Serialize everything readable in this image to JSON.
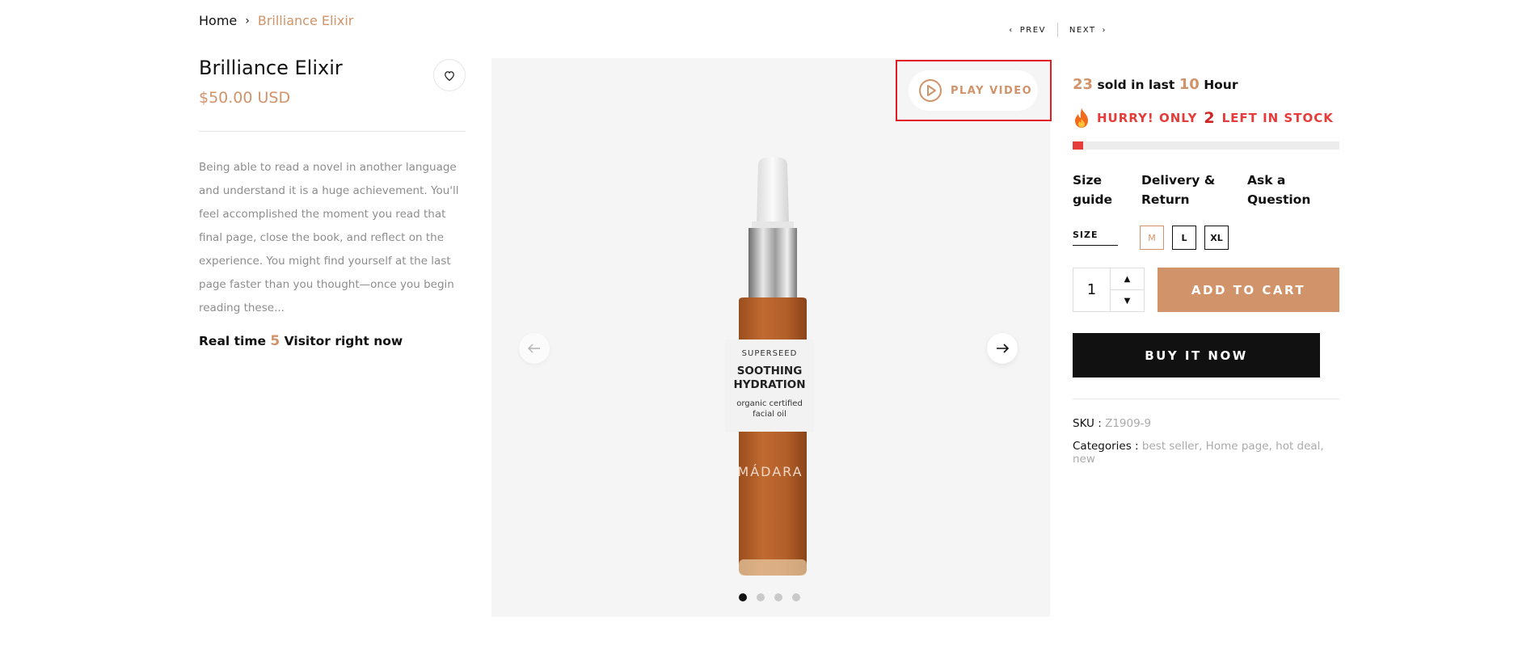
{
  "breadcrumb": {
    "home": "Home",
    "separator": "›",
    "current": "Brilliance Elixir"
  },
  "nav": {
    "prev": "PREV",
    "next": "NEXT"
  },
  "product": {
    "title": "Brilliance Elixir",
    "price": "$50.00 USD",
    "description": "Being able to read a novel in another language and understand it is a huge achievement. You'll feel accomplished the moment you read that final page, close the book, and reflect on the experience. You might find yourself at the last page faster than you thought—once you begin reading these...",
    "visitor_prefix": "Real time",
    "visitor_count": "5",
    "visitor_suffix": "Visitor right now"
  },
  "gallery": {
    "play_video": "PLAY VIDEO",
    "label_brand_line": "SUPERSEED",
    "label_title_1": "SOOTHING",
    "label_title_2": "HYDRATION",
    "label_sub_1": "organic certified",
    "label_sub_2": "facial oil",
    "bottle_brand": "MÁDARA",
    "active_dot": 1,
    "dot_count": 4
  },
  "sales": {
    "sold_count": "23",
    "sold_mid": "sold in last",
    "hours": "10",
    "hours_label": "Hour",
    "hurry_prefix": "HURRY! ONLY",
    "stock_left": "2",
    "hurry_suffix": "LEFT IN STOCK",
    "stock_fraction": 0.04
  },
  "links": {
    "size_guide_1": "Size",
    "size_guide_2": "guide",
    "delivery_1": "Delivery &",
    "delivery_2": "Return",
    "ask_1": "Ask a",
    "ask_2": "Question"
  },
  "size": {
    "label": "SIZE",
    "options": [
      "M",
      "L",
      "XL"
    ],
    "selected": "M"
  },
  "cart": {
    "quantity": "1",
    "add_to_cart": "ADD TO CART",
    "buy_now": "BUY IT NOW"
  },
  "meta": {
    "sku_label": "SKU :",
    "sku_value": "Z1909-9",
    "categories_label": "Categories :",
    "categories_value": "best seller, Home page, hot deal, new"
  },
  "colors": {
    "accent": "#d0936a",
    "alert": "#e63b3b",
    "dark": "#111111"
  },
  "icons": [
    "chevron-right-icon",
    "chevron-left-icon",
    "heart-icon",
    "play-icon",
    "arrow-left-icon",
    "arrow-right-icon",
    "fire-icon",
    "caret-up-icon",
    "caret-down-icon"
  ]
}
